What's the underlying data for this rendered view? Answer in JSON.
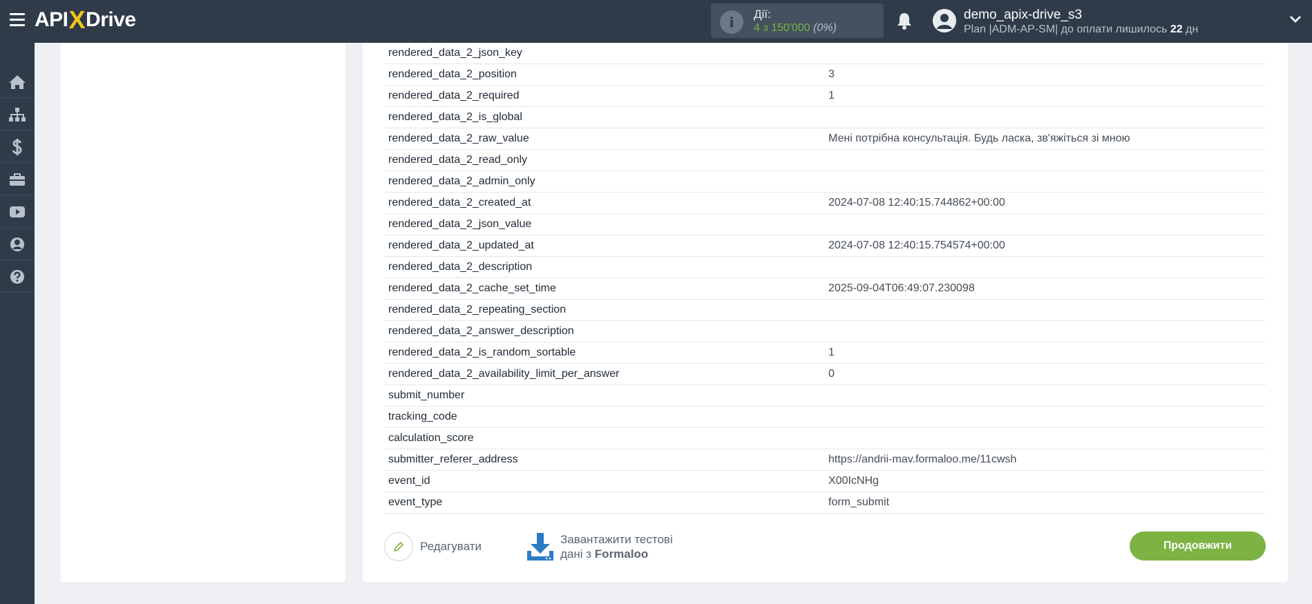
{
  "topbar": {
    "logo_left": "API",
    "logo_x": "X",
    "logo_right": "Drive",
    "actions_label": "Дії:",
    "actions_count": "4 з 150'000",
    "actions_pct": "(0%)",
    "user_name": "demo_apix-drive_s3",
    "plan_prefix": "Plan |ADM-AP-SM| до оплати лишилось",
    "plan_days": "22",
    "plan_suffix": "дн"
  },
  "sidebar": {
    "items": [
      "home-icon",
      "sitemap-icon",
      "dollar-icon",
      "briefcase-icon",
      "youtube-icon",
      "user-circle-icon",
      "help-icon"
    ]
  },
  "table": {
    "rows": [
      {
        "key": "rendered_data_2_json_key",
        "value": ""
      },
      {
        "key": "rendered_data_2_position",
        "value": "3"
      },
      {
        "key": "rendered_data_2_required",
        "value": "1"
      },
      {
        "key": "rendered_data_2_is_global",
        "value": ""
      },
      {
        "key": "rendered_data_2_raw_value",
        "value": "Мені потрібна консультація. Будь ласка, зв'яжіться зі мною"
      },
      {
        "key": "rendered_data_2_read_only",
        "value": ""
      },
      {
        "key": "rendered_data_2_admin_only",
        "value": ""
      },
      {
        "key": "rendered_data_2_created_at",
        "value": "2024-07-08 12:40:15.744862+00:00"
      },
      {
        "key": "rendered_data_2_json_value",
        "value": ""
      },
      {
        "key": "rendered_data_2_updated_at",
        "value": "2024-07-08 12:40:15.754574+00:00"
      },
      {
        "key": "rendered_data_2_description",
        "value": ""
      },
      {
        "key": "rendered_data_2_cache_set_time",
        "value": "2025-09-04T06:49:07.230098"
      },
      {
        "key": "rendered_data_2_repeating_section",
        "value": ""
      },
      {
        "key": "rendered_data_2_answer_description",
        "value": ""
      },
      {
        "key": "rendered_data_2_is_random_sortable",
        "value": "1"
      },
      {
        "key": "rendered_data_2_availability_limit_per_answer",
        "value": "0"
      },
      {
        "key": "submit_number",
        "value": ""
      },
      {
        "key": "tracking_code",
        "value": ""
      },
      {
        "key": "calculation_score",
        "value": ""
      },
      {
        "key": "submitter_referer_address",
        "value": "https://andrii-mav.formaloo.me/11cwsh"
      },
      {
        "key": "event_id",
        "value": "X00IcNHg"
      },
      {
        "key": "event_type",
        "value": "form_submit"
      }
    ]
  },
  "buttons": {
    "edit_label": "Редагувати",
    "download_line1": "Завантажити тестові",
    "download_line2_prefix": "дані з",
    "download_line2_source": "Formaloo",
    "continue_label": "Продовжити"
  },
  "colors": {
    "topbar": "#2f3b49",
    "accent_green": "#7cb342",
    "download_blue": "#2b7cc4",
    "logo_yellow": "#f5c518"
  }
}
